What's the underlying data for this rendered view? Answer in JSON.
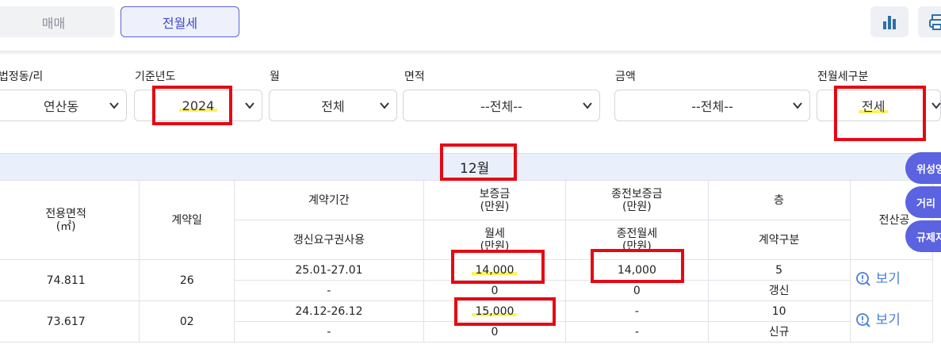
{
  "tabs": {
    "sale": "매매",
    "rent": "전월세"
  },
  "toolbar": {
    "chart_icon": "bar-chart-icon",
    "print_icon": "printer-icon"
  },
  "filters": {
    "dong": {
      "label": "법정동/리",
      "value": "연산동"
    },
    "year": {
      "label": "기준년도",
      "value": "2024"
    },
    "month": {
      "label": "월",
      "value": "전체"
    },
    "area": {
      "label": "면적",
      "value": "--전체--"
    },
    "amount": {
      "label": "금액",
      "value": "--전체--"
    },
    "rent_type": {
      "label": "전월세구분",
      "value": "전세"
    }
  },
  "table": {
    "month": "12월",
    "headers": {
      "area": "전용면적",
      "area_unit": "(㎡)",
      "date": "계약일",
      "period": "계약기간",
      "renewal": "갱신요구권사용",
      "deposit": "보증금",
      "deposit_unit": "(만원)",
      "monthly": "월세",
      "monthly_unit": "(만원)",
      "prev_deposit": "종전보증금",
      "prev_deposit_unit": "(만원)",
      "prev_monthly": "종전월세",
      "prev_monthly_unit": "(만원)",
      "floor": "층",
      "contract_type": "계약구분",
      "detail": "전산공"
    },
    "rows": [
      {
        "area": "74.811",
        "date": "26",
        "period": "25.01-27.01",
        "renewal": "-",
        "deposit": "14,000",
        "monthly": "0",
        "prev_deposit": "14,000",
        "prev_monthly": "0",
        "floor": "5",
        "contract_type": "갱신",
        "view": "보기"
      },
      {
        "area": "73.617",
        "date": "02",
        "period": "24.12-26.12",
        "renewal": "-",
        "deposit": "15,000",
        "monthly": "0",
        "prev_deposit": "-",
        "prev_monthly": "-",
        "floor": "10",
        "contract_type": "신규",
        "view": "보기"
      }
    ]
  },
  "side_buttons": [
    "위성영",
    "거리",
    "규제지"
  ],
  "colors": {
    "accent": "#5b63e0",
    "highlight_box": "#e50914",
    "marker": "#fff14d",
    "link": "#4a7fd6"
  }
}
